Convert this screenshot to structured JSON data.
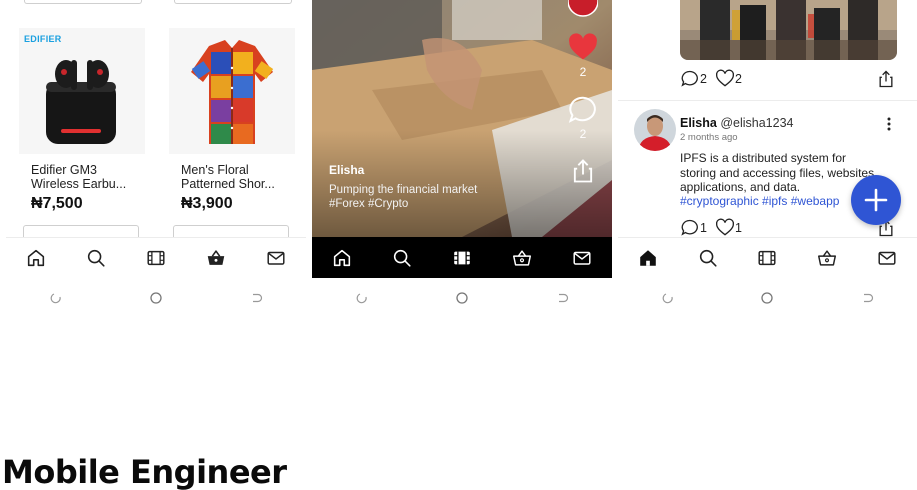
{
  "shop": {
    "brand_logo": "EDIFIER",
    "products": [
      {
        "name_line1": "Edifier GM3",
        "name_line2": "Wireless Earbu...",
        "price": "₦7,500"
      },
      {
        "name_line1": "Men's Floral",
        "name_line2": "Patterned Shor...",
        "price": "₦3,900"
      }
    ]
  },
  "video": {
    "author": "Elisha",
    "caption_line1": "Pumping the financial market",
    "caption_line2": "#Forex #Crypto",
    "like_count": "2",
    "comment_count": "2"
  },
  "feed": {
    "prev_post": {
      "comment_count": "2",
      "like_count": "2"
    },
    "post": {
      "author": "Elisha",
      "handle": "@elisha1234",
      "time": "2 months ago",
      "body_line1": "IPFS is a distributed system for",
      "body_line2": "storing and accessing files, websites,",
      "body_line3": "applications, and data.",
      "tags": "#cryptographic #ipfs #webapp",
      "comment_count": "1",
      "like_count": "1"
    }
  },
  "nav_icons": [
    "home-icon",
    "search-icon",
    "film-icon",
    "basket-icon",
    "mail-icon"
  ],
  "colors": {
    "accent": "#2f55d4",
    "like_red": "#e8363d",
    "brand_blue": "#1aa0e0"
  },
  "footer": {
    "heading": "Mobile Engineer"
  }
}
